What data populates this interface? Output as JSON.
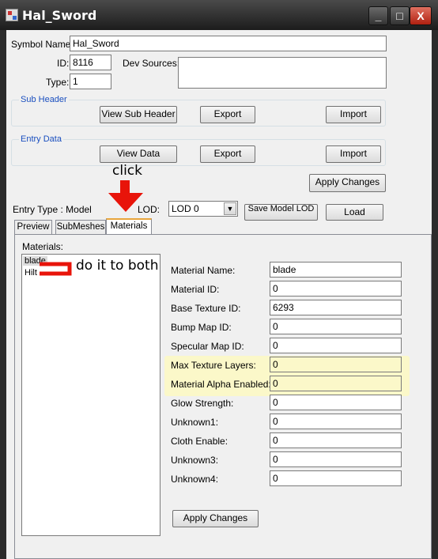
{
  "window": {
    "title": "Hal_Sword",
    "controls": [
      "_",
      "□",
      "X"
    ]
  },
  "fields": {
    "symbol_name_label": "Symbol Name:",
    "symbol_name_value": "Hal_Sword",
    "id_label": "ID:",
    "id_value": "8116",
    "type_label": "Type:",
    "type_value": "1",
    "dev_sources_label": "Dev Sources:",
    "dev_sources_value": ""
  },
  "sub_header": {
    "title": "Sub Header",
    "view_button": "View Sub Header",
    "export_button": "Export",
    "import_button": "Import"
  },
  "entry_data": {
    "title": "Entry Data",
    "view_button": "View Data",
    "export_button": "Export",
    "import_button": "Import"
  },
  "apply_changes_top": "Apply Changes",
  "model_row": {
    "entry_type_label": "Entry Type : Model",
    "lod_label": "LOD:",
    "lod_value": "LOD 0",
    "save_model_button": "Save Model LOD",
    "load_button": "Load"
  },
  "tabs": [
    {
      "label": "Preview"
    },
    {
      "label": "SubMeshes"
    },
    {
      "label": "Materials"
    }
  ],
  "materials": {
    "list_label": "Materials:",
    "items": [
      "blade",
      "Hilt"
    ],
    "properties": [
      {
        "label": "Material Name:",
        "value": "blade"
      },
      {
        "label": "Material ID:",
        "value": "0"
      },
      {
        "label": "Base Texture ID:",
        "value": "6293"
      },
      {
        "label": "Bump Map ID:",
        "value": "0"
      },
      {
        "label": "Specular Map ID:",
        "value": "0"
      },
      {
        "label": "Max Texture Layers:",
        "value": "0"
      },
      {
        "label": "Material Alpha Enabled:",
        "value": "0"
      },
      {
        "label": "Glow Strength:",
        "value": "0"
      },
      {
        "label": "Unknown1:",
        "value": "0"
      },
      {
        "label": "Cloth Enable:",
        "value": "0"
      },
      {
        "label": "Unknown3:",
        "value": "0"
      },
      {
        "label": "Unknown4:",
        "value": "0"
      }
    ],
    "apply_button": "Apply Changes"
  },
  "annotations": {
    "click": "click",
    "do_it": "do it to both"
  },
  "colors": {
    "annotation_red": "#e8140a",
    "highlight": "#fbf8c9",
    "group_title": "#1a4fbf"
  }
}
